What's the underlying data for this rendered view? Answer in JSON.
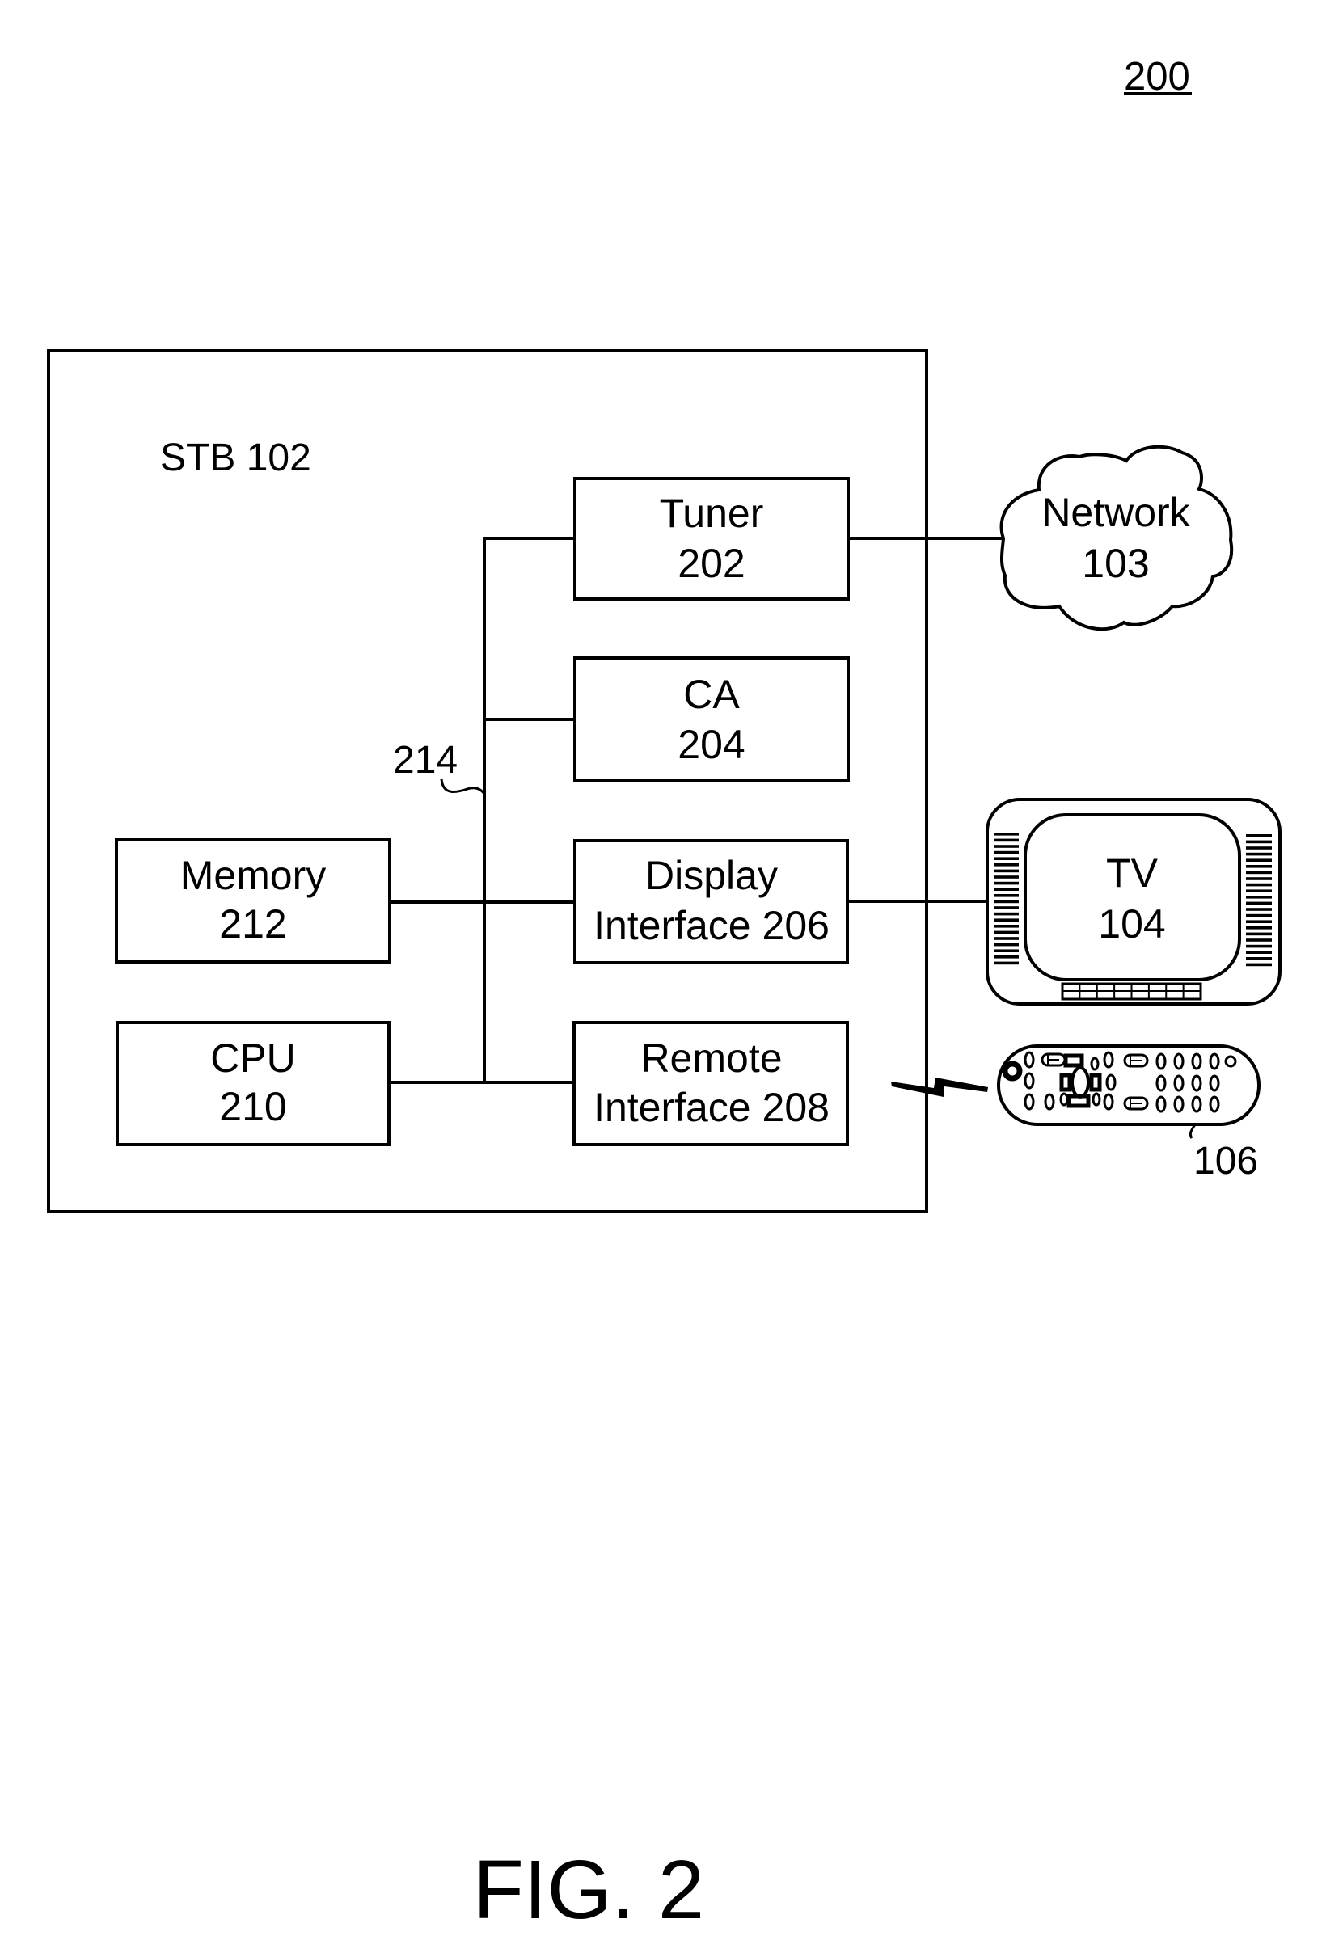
{
  "figure": {
    "number_label": "200",
    "caption": "FIG. 2"
  },
  "stb": {
    "label": "STB 102",
    "bus_label": "214",
    "components": {
      "tuner": {
        "line1": "Tuner",
        "line2": "202"
      },
      "ca": {
        "line1": "CA",
        "line2": "204"
      },
      "display_interface": {
        "line1": "Display",
        "line2": "Interface 206"
      },
      "remote_interface": {
        "line1": "Remote",
        "line2": "Interface 208"
      },
      "memory": {
        "line1": "Memory",
        "line2": "212"
      },
      "cpu": {
        "line1": "CPU",
        "line2": "210"
      }
    }
  },
  "external": {
    "network": {
      "line1": "Network",
      "line2": "103"
    },
    "tv": {
      "line1": "TV",
      "line2": "104"
    },
    "remote": {
      "label": "106"
    }
  }
}
